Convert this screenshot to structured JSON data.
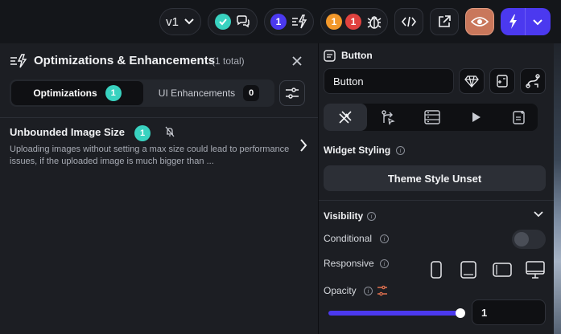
{
  "toolbar": {
    "version_label": "v1",
    "optimizations_count": "1",
    "warnings_count": "1",
    "errors_count": "1",
    "colors": {
      "teal": "#39d2c0",
      "purple": "#4b39ef",
      "orange": "#f2982b",
      "red": "#e0423f",
      "accent_eye": "#c9775b"
    }
  },
  "left_panel": {
    "title": "Optimizations & Enhancements",
    "total": "(1 total)",
    "tabs": [
      {
        "label": "Optimizations",
        "count": "1"
      },
      {
        "label": "UI Enhancements",
        "count": "0"
      }
    ],
    "items": [
      {
        "title": "Unbounded Image Size",
        "count": "1",
        "description": "Uploading images without setting a max size could lead to performance issues, if the uploaded image is much bigger than ..."
      }
    ]
  },
  "right_panel": {
    "widget_type": "Button",
    "widget_name": "Button",
    "widget_styling_label": "Widget Styling",
    "theme_style_button": "Theme Style Unset",
    "visibility_label": "Visibility",
    "conditional_label": "Conditional",
    "responsive_label": "Responsive",
    "opacity_label": "Opacity",
    "opacity_value": "1",
    "opacity_fraction": 1,
    "conditional_on": false
  }
}
